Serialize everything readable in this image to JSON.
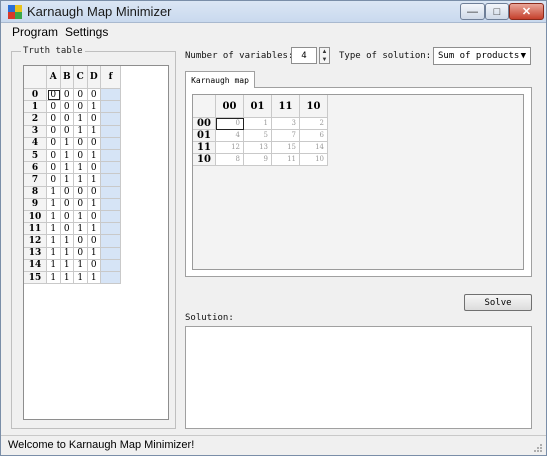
{
  "window": {
    "title": "Karnaugh Map Minimizer",
    "minimize_glyph": "—",
    "maximize_glyph": "□",
    "close_glyph": "✕"
  },
  "menu": {
    "items": [
      "Program",
      "Settings"
    ]
  },
  "truth_table": {
    "group_label": "Truth table",
    "headers": [
      "A",
      "B",
      "C",
      "D",
      "f"
    ],
    "rows": [
      {
        "index": "0",
        "bits": [
          "0",
          "0",
          "0",
          "0"
        ]
      },
      {
        "index": "1",
        "bits": [
          "0",
          "0",
          "0",
          "1"
        ]
      },
      {
        "index": "2",
        "bits": [
          "0",
          "0",
          "1",
          "0"
        ]
      },
      {
        "index": "3",
        "bits": [
          "0",
          "0",
          "1",
          "1"
        ]
      },
      {
        "index": "4",
        "bits": [
          "0",
          "1",
          "0",
          "0"
        ]
      },
      {
        "index": "5",
        "bits": [
          "0",
          "1",
          "0",
          "1"
        ]
      },
      {
        "index": "6",
        "bits": [
          "0",
          "1",
          "1",
          "0"
        ]
      },
      {
        "index": "7",
        "bits": [
          "0",
          "1",
          "1",
          "1"
        ]
      },
      {
        "index": "8",
        "bits": [
          "1",
          "0",
          "0",
          "0"
        ]
      },
      {
        "index": "9",
        "bits": [
          "1",
          "0",
          "0",
          "1"
        ]
      },
      {
        "index": "10",
        "bits": [
          "1",
          "0",
          "1",
          "0"
        ]
      },
      {
        "index": "11",
        "bits": [
          "1",
          "0",
          "1",
          "1"
        ]
      },
      {
        "index": "12",
        "bits": [
          "1",
          "1",
          "0",
          "0"
        ]
      },
      {
        "index": "13",
        "bits": [
          "1",
          "1",
          "0",
          "1"
        ]
      },
      {
        "index": "14",
        "bits": [
          "1",
          "1",
          "1",
          "0"
        ]
      },
      {
        "index": "15",
        "bits": [
          "1",
          "1",
          "1",
          "1"
        ]
      }
    ]
  },
  "controls": {
    "num_vars_label": "Number of variables:",
    "num_vars_value": "4",
    "solution_type_label": "Type of solution:",
    "solution_type_value": "Sum of products"
  },
  "kmap": {
    "tab_label": "Karnaugh map",
    "col_headers": [
      "00",
      "01",
      "11",
      "10"
    ],
    "row_headers": [
      "00",
      "01",
      "11",
      "10"
    ],
    "cells": [
      [
        "0",
        "1",
        "3",
        "2"
      ],
      [
        "4",
        "5",
        "7",
        "6"
      ],
      [
        "12",
        "13",
        "15",
        "14"
      ],
      [
        "8",
        "9",
        "11",
        "10"
      ]
    ]
  },
  "solve_label": "Solve",
  "solution_label": "Solution:",
  "status_text": "Welcome to Karnaugh Map Minimizer!",
  "colors": {
    "f_column": "#d6e4f6",
    "titlebar": "#c9d9ee",
    "close_button": "#c5402c"
  }
}
